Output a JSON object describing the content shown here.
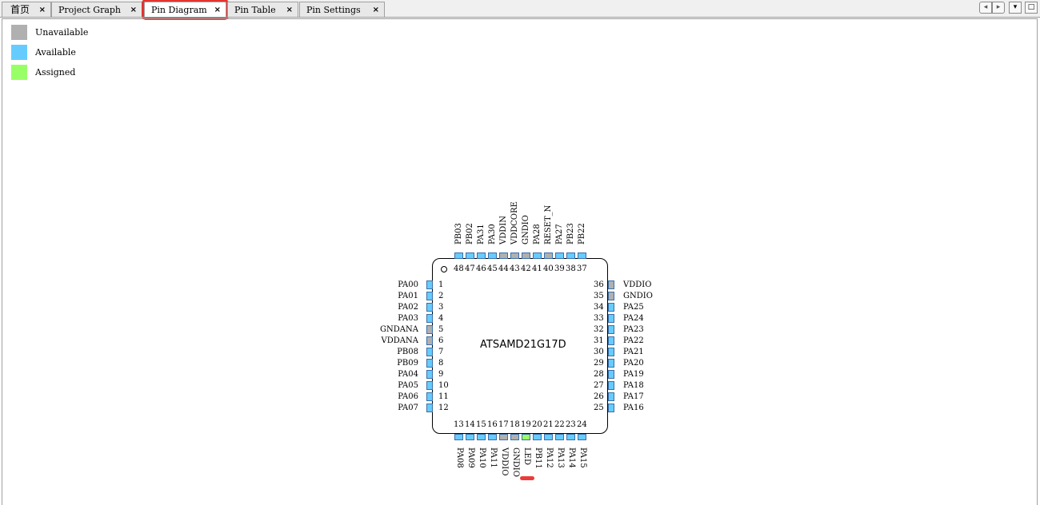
{
  "tabs": [
    {
      "label": "首页",
      "close": "×"
    },
    {
      "label": "Project Graph",
      "close": "×"
    },
    {
      "label": "Pin Diagram",
      "close": "×"
    },
    {
      "label": "Pin Table",
      "close": "×"
    },
    {
      "label": "Pin Settings",
      "close": "×"
    }
  ],
  "tab_controls": {
    "left_icon": "chevron-left-icon",
    "right_icon": "chevron-right-icon",
    "menu_icon": "dropdown-icon",
    "maximize_icon": "maximize-icon"
  },
  "legend": [
    {
      "label": "Unavailable",
      "color": "#b0b0b0"
    },
    {
      "label": "Available",
      "color": "#66ccff"
    },
    {
      "label": "Assigned",
      "color": "#99ff66"
    }
  ],
  "chip": {
    "name": "ATSAMD21G17D",
    "pins_left": [
      {
        "num": "1",
        "label": "PA00",
        "state": "available"
      },
      {
        "num": "2",
        "label": "PA01",
        "state": "available"
      },
      {
        "num": "3",
        "label": "PA02",
        "state": "available"
      },
      {
        "num": "4",
        "label": "PA03",
        "state": "available"
      },
      {
        "num": "5",
        "label": "GNDANA",
        "state": "unavailable"
      },
      {
        "num": "6",
        "label": "VDDANA",
        "state": "unavailable"
      },
      {
        "num": "7",
        "label": "PB08",
        "state": "available"
      },
      {
        "num": "8",
        "label": "PB09",
        "state": "available"
      },
      {
        "num": "9",
        "label": "PA04",
        "state": "available"
      },
      {
        "num": "10",
        "label": "PA05",
        "state": "available"
      },
      {
        "num": "11",
        "label": "PA06",
        "state": "available"
      },
      {
        "num": "12",
        "label": "PA07",
        "state": "available"
      }
    ],
    "pins_bottom": [
      {
        "num": "13",
        "label": "PA08",
        "state": "available"
      },
      {
        "num": "14",
        "label": "PA09",
        "state": "available"
      },
      {
        "num": "15",
        "label": "PA10",
        "state": "available"
      },
      {
        "num": "16",
        "label": "PA11",
        "state": "available"
      },
      {
        "num": "17",
        "label": "VDDIO",
        "state": "unavailable"
      },
      {
        "num": "18",
        "label": "GNDIO",
        "state": "unavailable"
      },
      {
        "num": "19",
        "label": "LED",
        "state": "assigned"
      },
      {
        "num": "20",
        "label": "PB11",
        "state": "available"
      },
      {
        "num": "21",
        "label": "PA12",
        "state": "available"
      },
      {
        "num": "22",
        "label": "PA13",
        "state": "available"
      },
      {
        "num": "23",
        "label": "PA14",
        "state": "available"
      },
      {
        "num": "24",
        "label": "PA15",
        "state": "available"
      }
    ],
    "pins_right": [
      {
        "num": "25",
        "label": "PA16",
        "state": "available"
      },
      {
        "num": "26",
        "label": "PA17",
        "state": "available"
      },
      {
        "num": "27",
        "label": "PA18",
        "state": "available"
      },
      {
        "num": "28",
        "label": "PA19",
        "state": "available"
      },
      {
        "num": "29",
        "label": "PA20",
        "state": "available"
      },
      {
        "num": "30",
        "label": "PA21",
        "state": "available"
      },
      {
        "num": "31",
        "label": "PA22",
        "state": "available"
      },
      {
        "num": "32",
        "label": "PA23",
        "state": "available"
      },
      {
        "num": "33",
        "label": "PA24",
        "state": "available"
      },
      {
        "num": "34",
        "label": "PA25",
        "state": "available"
      },
      {
        "num": "35",
        "label": "GNDIO",
        "state": "unavailable"
      },
      {
        "num": "36",
        "label": "VDDIO",
        "state": "unavailable"
      }
    ],
    "pins_top": [
      {
        "num": "37",
        "label": "PB22",
        "state": "available"
      },
      {
        "num": "38",
        "label": "PB23",
        "state": "available"
      },
      {
        "num": "39",
        "label": "PA27",
        "state": "available"
      },
      {
        "num": "40",
        "label": "RESET_N",
        "state": "unavailable"
      },
      {
        "num": "41",
        "label": "PA28",
        "state": "available"
      },
      {
        "num": "42",
        "label": "GNDIO",
        "state": "unavailable"
      },
      {
        "num": "43",
        "label": "VDDCORE",
        "state": "unavailable"
      },
      {
        "num": "44",
        "label": "VDDIN",
        "state": "unavailable"
      },
      {
        "num": "45",
        "label": "PA30",
        "state": "available"
      },
      {
        "num": "46",
        "label": "PA31",
        "state": "available"
      },
      {
        "num": "47",
        "label": "PB02",
        "state": "available"
      },
      {
        "num": "48",
        "label": "PB03",
        "state": "available"
      }
    ]
  }
}
